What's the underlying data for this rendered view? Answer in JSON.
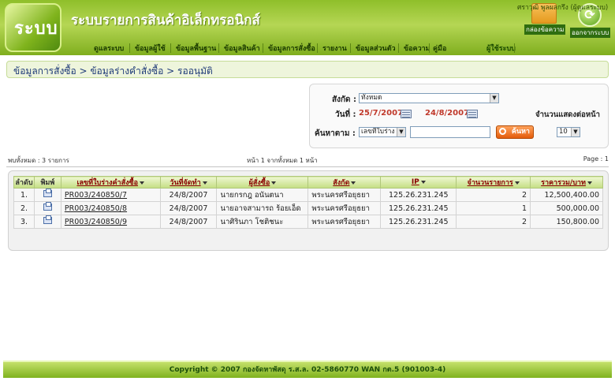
{
  "app": {
    "logo_text": "ระบบ",
    "title": "ระบบรายการสินค้าอิเล็กทรอนิกส์"
  },
  "header_tools": {
    "inbox_label": "กล่องข้อความ",
    "logout_label": "ออกจากระบบ"
  },
  "menu": [
    {
      "label": "ดูแลระบบ"
    },
    {
      "label": "ข้อมูลผู้ใช้"
    },
    {
      "label": "ข้อมูลพื้นฐาน"
    },
    {
      "label": "ข้อมูลสินค้า"
    },
    {
      "label": "ข้อมูลการสั่งซื้อ"
    },
    {
      "label": "รายงาน"
    },
    {
      "label": "ข้อมูลส่วนตัว"
    },
    {
      "label": "ข้อความ"
    },
    {
      "label": "คู่มือ"
    }
  ],
  "user": {
    "label": "ผู้ใช้ระบบ",
    "name": "ศราวุฒิ พูลผลกรึง (ผู้ดูแลระบบ)"
  },
  "breadcrumb": "ข้อมูลการสั่งซื้อ > ข้อมูลร่างคำสั่งซื้อ > รออนุมัติ",
  "search": {
    "affiliation_label": "สังกัด :",
    "affiliation_value": "ทั้งหมด",
    "date_label": "วันที่ :",
    "date_from": "25/7/2007",
    "date_to": "24/8/2007",
    "per_page_label": "จำนวนแสดงต่อหน้า",
    "per_page_value": "10",
    "find_label": "ค้นหาตาม :",
    "find_by_value": "เลขที่ใบร่าง",
    "find_input_value": "",
    "search_button": "ค้นหา"
  },
  "stats": {
    "total": "พบทั้งหมด : 3 รายการ",
    "page_of": "หน้า 1 จากทั้งหมด 1 หน้า",
    "page": "Page : 1"
  },
  "table": {
    "headers": [
      "ลำดับ",
      "พิมพ์",
      "เลขที่ใบร่างคำสั่งซื้อ",
      "วันที่จัดทำ",
      "ผู้สั่งซื้อ",
      "สังกัด",
      "IP",
      "จำนวนรายการ",
      "ราคารวม/บาท"
    ],
    "rows": [
      {
        "no": "1.",
        "draft_no": "PR003/240850/7",
        "date": "24/8/2007",
        "buyer": "นายกรกฎ อนันตนา",
        "unit": "พระนครศรีอยุธยา",
        "ip": "125.26.231.245",
        "items": "2",
        "total": "12,500,400.00"
      },
      {
        "no": "2.",
        "draft_no": "PR003/240850/8",
        "date": "24/8/2007",
        "buyer": "นายอาจสามารถ ร้อยเอ็ด",
        "unit": "พระนครศรีอยุธยา",
        "ip": "125.26.231.245",
        "items": "1",
        "total": "500,000.00"
      },
      {
        "no": "3.",
        "draft_no": "PR003/240850/9",
        "date": "24/8/2007",
        "buyer": "นาศิรินภา โชติชนะ",
        "unit": "พระนครศรีอยุธยา",
        "ip": "125.26.231.245",
        "items": "2",
        "total": "150,800.00"
      }
    ]
  },
  "footer": "Copyright © 2007 กองจัดหาพัสดุ ร.ส.ล. 02-5860770 WAN กต.5 (901003-4)"
}
